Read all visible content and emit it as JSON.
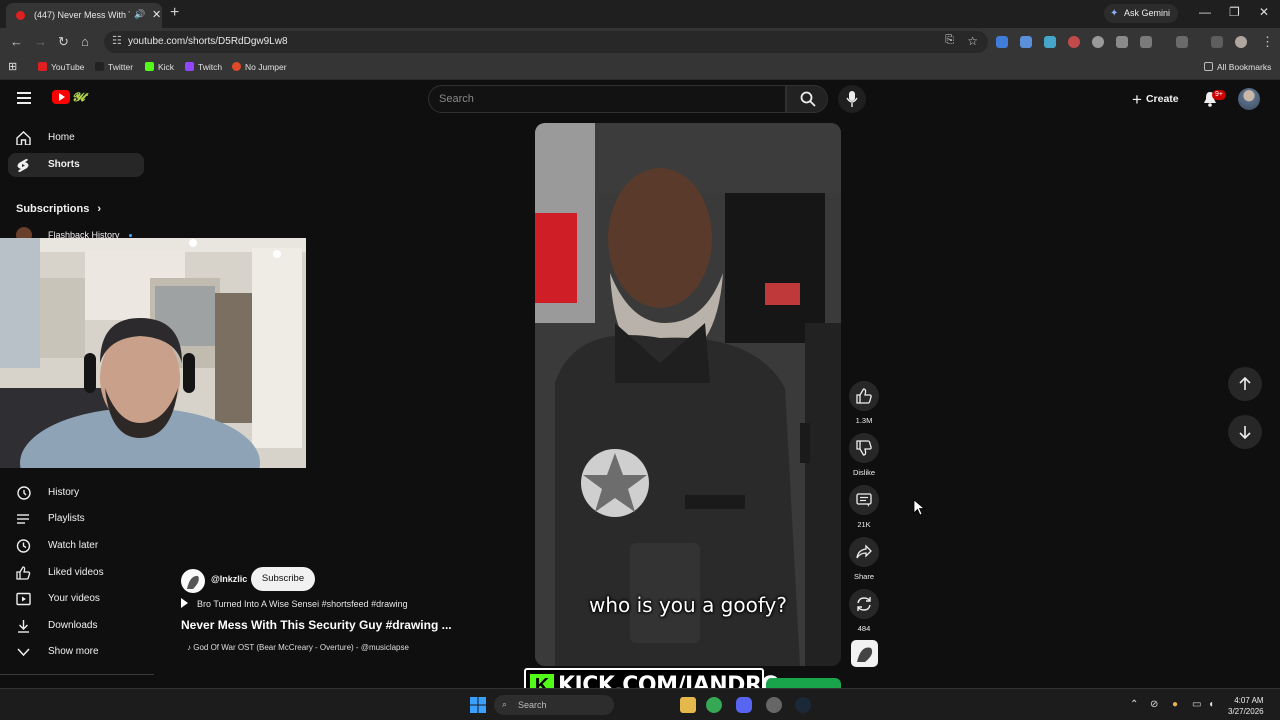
{
  "browser": {
    "tab_title": "(447) Never Mess With This",
    "new_tab": "+",
    "ask_gemini": "Ask Gemini",
    "url": "youtube.com/shorts/D5RdDgw9Lw8",
    "bookmarks": [
      "YouTube",
      "Twitter",
      "Kick",
      "Twitch",
      "No Jumper"
    ],
    "all_bookmarks": "All Bookmarks"
  },
  "youtube": {
    "search_placeholder": "Search",
    "create_label": "Create",
    "notification_badge": "9+",
    "nav": {
      "home": "Home",
      "shorts": "Shorts",
      "subscriptions": "Subscriptions",
      "flashback": "Flashback History",
      "history": "History",
      "playlists": "Playlists",
      "watch_later": "Watch later",
      "liked": "Liked videos",
      "your_videos": "Your videos",
      "downloads": "Downloads",
      "show_more": "Show more"
    },
    "short": {
      "caption": "who is you a goofy?",
      "likes": "1.3M",
      "dislike_label": "Dislike",
      "comments": "21K",
      "share_label": "Share",
      "remix": "484",
      "channel": "@Inkzlic",
      "subscribe": "Subscribe",
      "description": "Bro Turned Into A Wise Sensei #shortsfeed #drawing",
      "title": "Never Mess With This Security Guy #drawing ...",
      "music": "God Of War OST (Bear McCreary - Overture) - @musiclapse"
    }
  },
  "overlay": {
    "kick_text": "KICK.COM/JANDRO"
  },
  "taskbar": {
    "search": "Search",
    "time": "4:07 AM",
    "date": "3/27/2026"
  },
  "colors": {
    "yt_red": "#ff0000",
    "kick_green": "#53fc18",
    "bg": "#0f0f0f"
  }
}
